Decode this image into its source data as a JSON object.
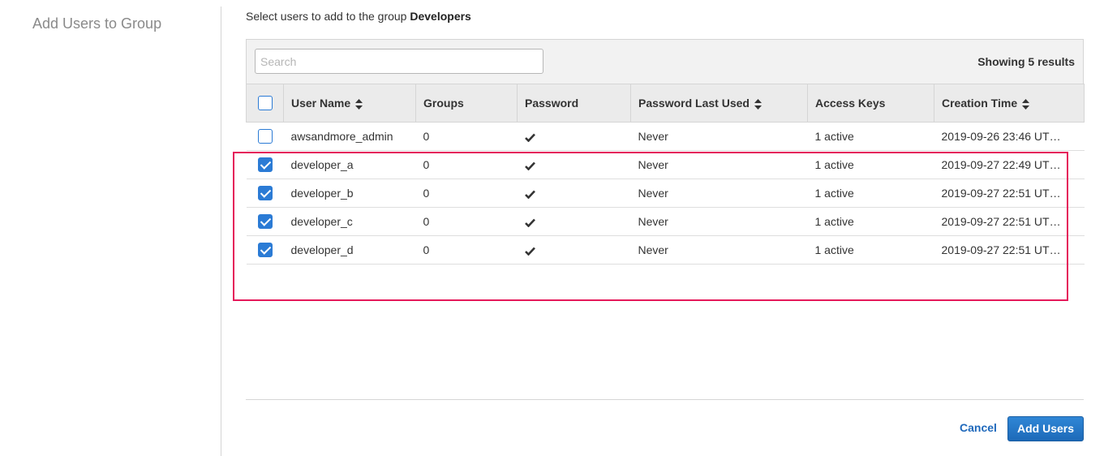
{
  "left_title": "Add Users to Group",
  "instruction": {
    "prefix": "Select users to add to the group",
    "group_name": "Developers"
  },
  "search": {
    "placeholder": "Search",
    "value": ""
  },
  "results_text": "Showing 5 results",
  "table": {
    "headers": {
      "user_name": "User Name",
      "groups": "Groups",
      "password": "Password",
      "password_last_used": "Password Last Used",
      "access_keys": "Access Keys",
      "creation_time": "Creation Time"
    },
    "sortable": [
      "user_name",
      "password_last_used",
      "creation_time"
    ],
    "rows": [
      {
        "checked": false,
        "user_name": "awsandmore_admin",
        "groups": "0",
        "password": "check-icon",
        "password_last_used": "Never",
        "access_keys": "1 active",
        "creation_time": "2019-09-26 23:46 UT…"
      },
      {
        "checked": true,
        "user_name": "developer_a",
        "groups": "0",
        "password": "check-icon",
        "password_last_used": "Never",
        "access_keys": "1 active",
        "creation_time": "2019-09-27 22:49 UT…"
      },
      {
        "checked": true,
        "user_name": "developer_b",
        "groups": "0",
        "password": "check-icon",
        "password_last_used": "Never",
        "access_keys": "1 active",
        "creation_time": "2019-09-27 22:51 UT…"
      },
      {
        "checked": true,
        "user_name": "developer_c",
        "groups": "0",
        "password": "check-icon",
        "password_last_used": "Never",
        "access_keys": "1 active",
        "creation_time": "2019-09-27 22:51 UT…"
      },
      {
        "checked": true,
        "user_name": "developer_d",
        "groups": "0",
        "password": "check-icon",
        "password_last_used": "Never",
        "access_keys": "1 active",
        "creation_time": "2019-09-27 22:51 UT…"
      }
    ]
  },
  "footer": {
    "cancel_label": "Cancel",
    "add_label": "Add Users"
  },
  "colors": {
    "accent": "#2b7bd5",
    "highlight_border": "#e5195a",
    "link": "#1e68bb"
  }
}
